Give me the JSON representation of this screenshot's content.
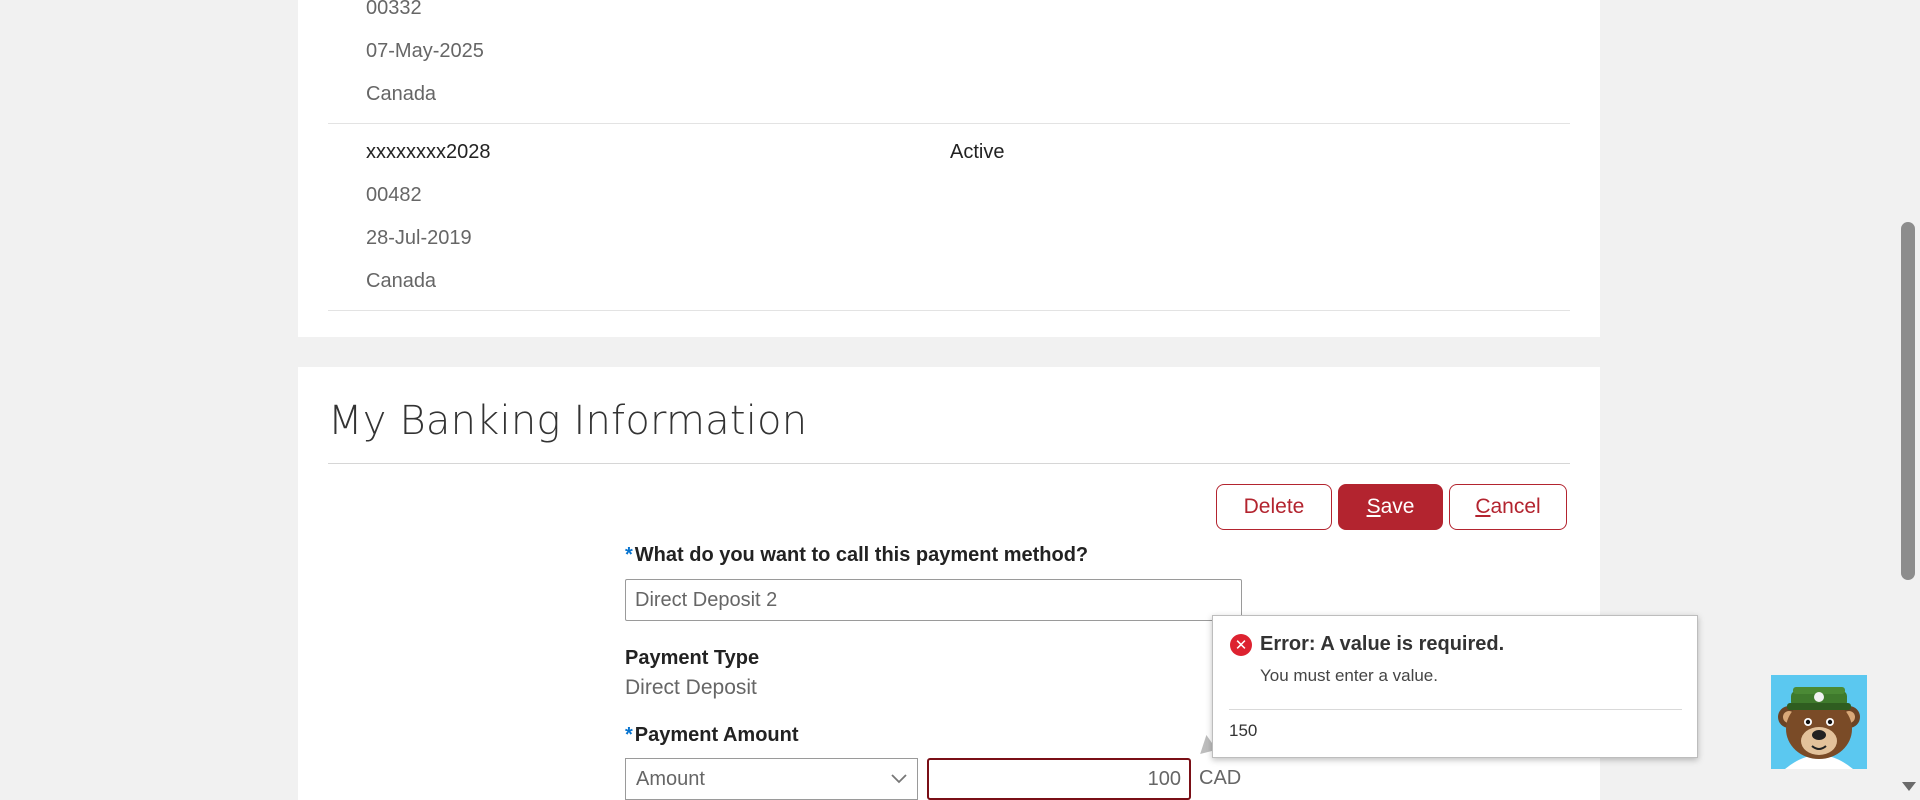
{
  "accounts": [
    {
      "lines": [
        "00332",
        "07-May-2025",
        "Canada"
      ],
      "status": ""
    },
    {
      "number": "xxxxxxxx2028",
      "lines": [
        "00482",
        "28-Jul-2019",
        "Canada"
      ],
      "status": "Active"
    }
  ],
  "banking": {
    "title": "My Banking Information",
    "buttons": {
      "delete": "Delete",
      "save_first": "S",
      "save_rest": "ave",
      "cancel_first": "C",
      "cancel_rest": "ancel"
    },
    "required_marker": "*",
    "name_label": "What do you want to call this payment method?",
    "name_value": "Direct Deposit 2",
    "payment_type_label": "Payment Type",
    "payment_type_value": "Direct Deposit",
    "amount_label": "Payment Amount",
    "amount_type_selected": "Amount",
    "amount_value": "100",
    "currency": "CAD"
  },
  "error_popup": {
    "title": "Error: A value is required.",
    "message": "You must enter a value.",
    "hint_value": "150"
  },
  "icons": {
    "error": "error-circle-icon",
    "dropdown": "chevron-down-icon",
    "assistant": "bear-mascot-avatar"
  },
  "colors": {
    "brand": "#b3242f",
    "error": "#dd2230",
    "required": "#0572ce"
  }
}
